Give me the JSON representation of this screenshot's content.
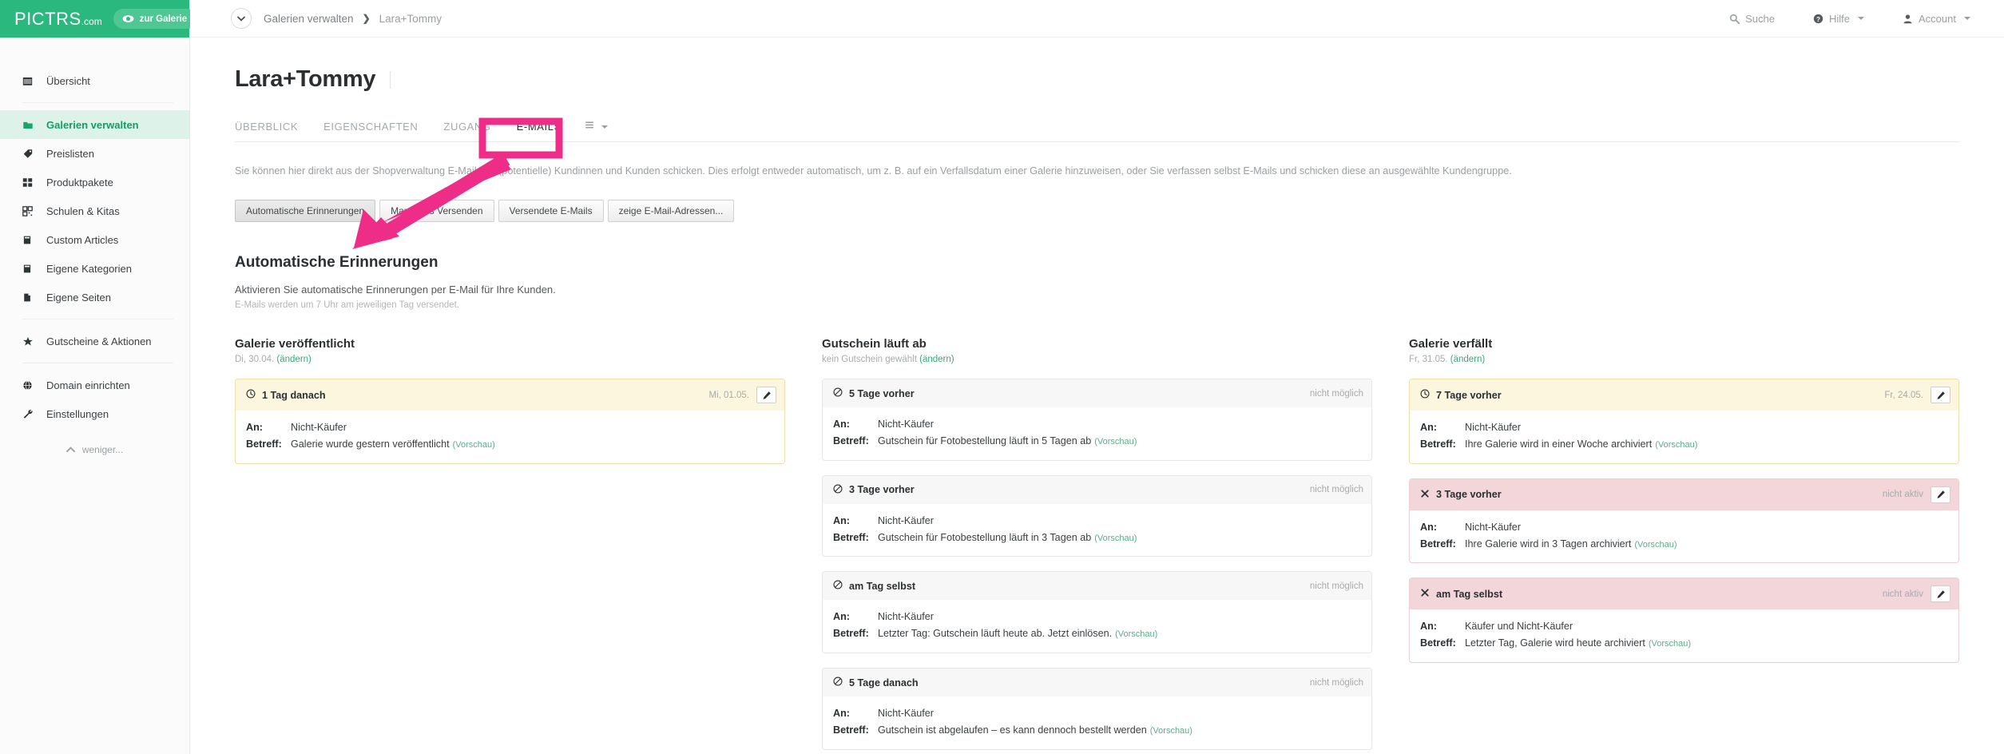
{
  "brand": {
    "logo_main": "PICTRS",
    "logo_domain": ".com",
    "gallery_button": "zur Galerie",
    "accent_green": "#2ab87e"
  },
  "sidebar": {
    "items": [
      {
        "label": "Übersicht",
        "icon": "calendar-icon",
        "active": false
      },
      {
        "label": "Galerien verwalten",
        "icon": "folder-icon",
        "active": true
      },
      {
        "label": "Preislisten",
        "icon": "tag-icon",
        "active": false
      },
      {
        "label": "Produktpakete",
        "icon": "grid-icon",
        "active": false
      },
      {
        "label": "Schulen & Kitas",
        "icon": "qr-icon",
        "active": false
      },
      {
        "label": "Custom Articles",
        "icon": "book-icon",
        "active": false
      },
      {
        "label": "Eigene Kategorien",
        "icon": "book-icon",
        "active": false
      },
      {
        "label": "Eigene Seiten",
        "icon": "page-icon",
        "active": false
      },
      {
        "label": "Gutscheine & Aktionen",
        "icon": "star-icon",
        "active": false
      },
      {
        "label": "Domain einrichten",
        "icon": "globe-icon",
        "active": false
      },
      {
        "label": "Einstellungen",
        "icon": "wrench-icon",
        "active": false
      }
    ],
    "collapse_label": "weniger..."
  },
  "topbar": {
    "breadcrumb": {
      "parent": "Galerien verwalten",
      "separator": "❯",
      "current": "Lara+Tommy"
    },
    "right_items": [
      {
        "label": "Suche",
        "icon": "search-icon",
        "has_caret": false
      },
      {
        "label": "Hilfe",
        "icon": "help-circle-icon",
        "has_caret": true
      },
      {
        "label": "Account",
        "icon": "user-icon",
        "has_caret": true
      }
    ]
  },
  "page": {
    "title": "Lara+Tommy",
    "tabs": [
      {
        "label": "ÜBERBLICK",
        "active": false
      },
      {
        "label": "EIGENSCHAFTEN",
        "active": false
      },
      {
        "label": "ZUGANG",
        "active": false
      },
      {
        "label": "E-MAILS",
        "active": true
      }
    ],
    "tab_menu_icon": "list-menu-icon",
    "description": "Sie können hier direkt aus der Shopverwaltung E-Mails an (potentielle) Kundinnen und Kunden schicken. Dies erfolgt entweder automatisch, um z. B. auf ein Verfallsdatum einer Galerie hinzuweisen, oder Sie verfassen selbst E-Mails und schicken diese an ausgewählte Kundengruppe.",
    "subtabs": [
      {
        "label": "Automatische Erinnerungen",
        "active": true
      },
      {
        "label": "Manuelles Versenden",
        "active": false
      },
      {
        "label": "Versendete E-Mails",
        "active": false
      },
      {
        "label": "zeige E-Mail-Adressen...",
        "active": false
      }
    ],
    "section_title": "Automatische Erinnerungen",
    "section_sub1": "Aktivieren Sie automatische Erinnerungen per E-Mail für Ihre Kunden.",
    "section_sub2": "E-Mails werden um 7 Uhr am jeweiligen Tag versendet.",
    "labels": {
      "to": "An:",
      "subject": "Betreff:",
      "preview": "(Vorschau)",
      "change": "(ändern)"
    }
  },
  "columns": [
    {
      "title": "Galerie veröffentlicht",
      "sub_prefix": "Di, 30.04. ",
      "sub_link": "(ändern)",
      "cards": [
        {
          "state": "warn",
          "status_icon": "clock-icon",
          "heading": "1 Tag danach",
          "status_text": "Mi, 01.05.",
          "has_edit": true,
          "to": "Nicht-Käufer",
          "subject": "Galerie wurde gestern veröffentlicht"
        }
      ]
    },
    {
      "title": "Gutschein läuft ab",
      "sub_prefix": "kein Gutschein gewählt ",
      "sub_link": "(ändern)",
      "cards": [
        {
          "state": "plain",
          "status_icon": "ban-icon",
          "heading": "5 Tage vorher",
          "status_text": "nicht möglich",
          "has_edit": false,
          "to": "Nicht-Käufer",
          "subject": "Gutschein für Fotobestellung läuft in 5 Tagen ab"
        },
        {
          "state": "plain",
          "status_icon": "ban-icon",
          "heading": "3 Tage vorher",
          "status_text": "nicht möglich",
          "has_edit": false,
          "to": "Nicht-Käufer",
          "subject": "Gutschein für Fotobestellung läuft in 3 Tagen ab"
        },
        {
          "state": "plain",
          "status_icon": "ban-icon",
          "heading": "am Tag selbst",
          "status_text": "nicht möglich",
          "has_edit": false,
          "to": "Nicht-Käufer",
          "subject": "Letzter Tag: Gutschein läuft heute ab. Jetzt einlösen."
        },
        {
          "state": "plain",
          "status_icon": "ban-icon",
          "heading": "5 Tage danach",
          "status_text": "nicht möglich",
          "has_edit": false,
          "to": "Nicht-Käufer",
          "subject": "Gutschein ist abgelaufen – es kann dennoch bestellt werden"
        }
      ]
    },
    {
      "title": "Galerie verfällt",
      "sub_prefix": "Fr, 31.05. ",
      "sub_link": "(ändern)",
      "cards": [
        {
          "state": "warn",
          "status_icon": "clock-icon",
          "heading": "7 Tage vorher",
          "status_text": "Fr, 24.05.",
          "has_edit": true,
          "to": "Nicht-Käufer",
          "subject": "Ihre Galerie wird in einer Woche archiviert"
        },
        {
          "state": "danger",
          "status_icon": "x-icon",
          "heading": "3 Tage vorher",
          "status_text": "nicht aktiv",
          "has_edit": true,
          "to": "Nicht-Käufer",
          "subject": "Ihre Galerie wird in 3 Tagen archiviert"
        },
        {
          "state": "danger",
          "status_icon": "x-icon",
          "heading": "am Tag selbst",
          "status_text": "nicht aktiv",
          "has_edit": true,
          "to": "Käufer und Nicht-Käufer",
          "subject": "Letzter Tag, Galerie wird heute archiviert"
        }
      ]
    }
  ],
  "annotation": {
    "color": "#ee2d88",
    "highlight_target": "E-MAILS",
    "arrow_target": "Automatische Erinnerungen"
  }
}
